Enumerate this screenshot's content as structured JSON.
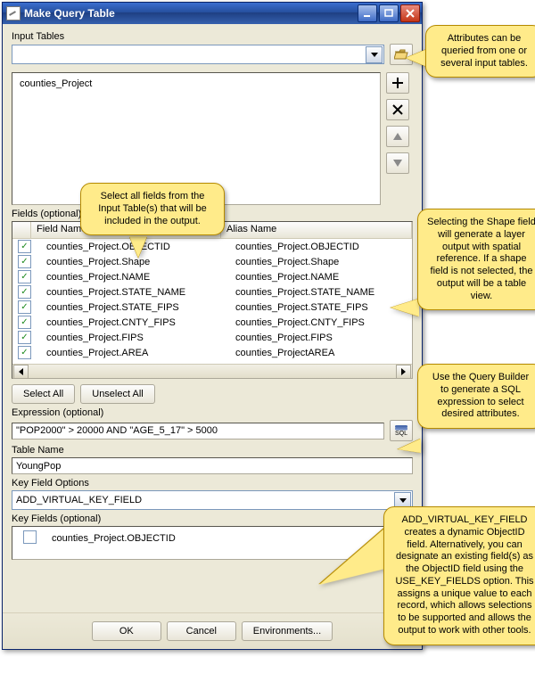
{
  "window": {
    "title": "Make Query Table"
  },
  "input_tables": {
    "label": "Input Tables",
    "list": [
      "counties_Project"
    ]
  },
  "fields": {
    "label": "Fields (optional)",
    "header_field": "Field Name",
    "header_alias": "Alias Name",
    "rows": [
      {
        "checked": true,
        "field": "counties_Project.OBJECTID",
        "alias": "counties_Project.OBJECTID"
      },
      {
        "checked": true,
        "field": "counties_Project.Shape",
        "alias": "counties_Project.Shape"
      },
      {
        "checked": true,
        "field": "counties_Project.NAME",
        "alias": "counties_Project.NAME"
      },
      {
        "checked": true,
        "field": "counties_Project.STATE_NAME",
        "alias": "counties_Project.STATE_NAME"
      },
      {
        "checked": true,
        "field": "counties_Project.STATE_FIPS",
        "alias": "counties_Project.STATE_FIPS"
      },
      {
        "checked": true,
        "field": "counties_Project.CNTY_FIPS",
        "alias": "counties_Project.CNTY_FIPS"
      },
      {
        "checked": true,
        "field": "counties_Project.FIPS",
        "alias": "counties_Project.FIPS"
      },
      {
        "checked": true,
        "field": "counties_Project.AREA",
        "alias": "counties_ProjectAREA"
      }
    ],
    "select_all": "Select All",
    "unselect_all": "Unselect All"
  },
  "expression": {
    "label": "Expression (optional)",
    "value": "\"POP2000\" > 20000 AND \"AGE_5_17\" > 5000"
  },
  "table_name": {
    "label": "Table Name",
    "value": "YoungPop"
  },
  "key_options": {
    "label": "Key Field Options",
    "value": "ADD_VIRTUAL_KEY_FIELD"
  },
  "key_fields": {
    "label": "Key Fields (optional)",
    "rows": [
      {
        "checked": false,
        "field": "counties_Project.OBJECTID"
      }
    ]
  },
  "footer": {
    "ok": "OK",
    "cancel": "Cancel",
    "env": "Environments..."
  },
  "sql_btn": "SQL",
  "callouts": {
    "c1": "Attributes can be queried from one or several input tables.",
    "c2": "Select all fields from the Input Table(s) that will be included in the output.",
    "c3": "Selecting the Shape field will generate a layer output with spatial reference. If a shape field is not selected, the output will be a table view.",
    "c4": "Use the Query Builder to generate a SQL expression to select desired attributes.",
    "c5": "ADD_VIRTUAL_KEY_FIELD creates a dynamic ObjectID field.  Alternatively, you can designate an existing field(s) as the ObjectID field using the USE_KEY_FIELDS option. This assigns a unique value to each record, which allows selections to be supported and allows the output to work with other tools."
  }
}
